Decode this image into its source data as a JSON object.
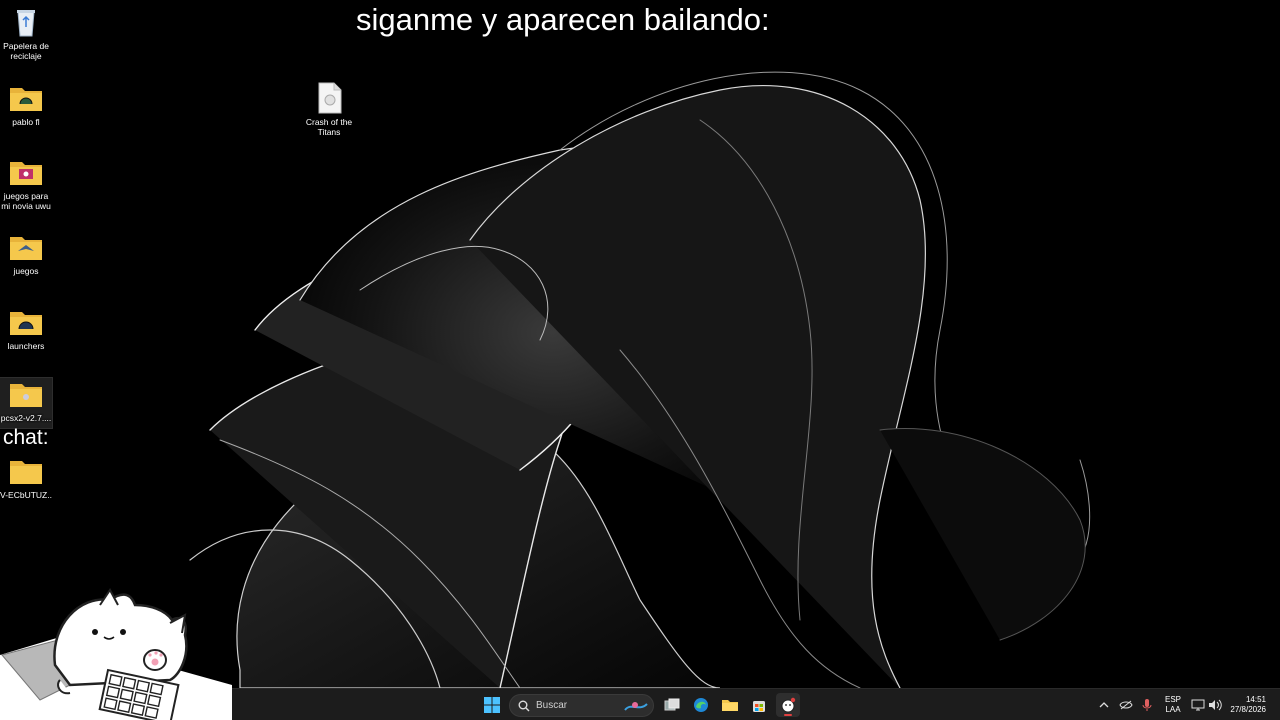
{
  "overlay": {
    "title": "siganme y aparecen bailando:",
    "chat_label": "chat:"
  },
  "desktop_icons": [
    {
      "label": "Papelera de reciclaje",
      "icon": "recycle-bin-icon"
    },
    {
      "label": "pablo fl",
      "icon": "folder-icon"
    },
    {
      "label": "juegos para mi novia uwu",
      "icon": "folder-icon"
    },
    {
      "label": "juegos",
      "icon": "folder-icon"
    },
    {
      "label": "launchers",
      "icon": "folder-icon"
    },
    {
      "label": "pcsx2-v2.7....",
      "icon": "folder-icon"
    },
    {
      "label": "V-ECbUTUZ...",
      "icon": "folder-icon"
    },
    {
      "label": "Crash of the Titans",
      "icon": "file-icon"
    }
  ],
  "taskbar": {
    "search_placeholder": "Buscar",
    "pinned": [
      "start-icon",
      "search-icon",
      "task-view-icon",
      "edge-icon",
      "file-explorer-icon",
      "store-icon",
      "bongo-app-icon"
    ],
    "tray": {
      "language_top": "ESP",
      "language_bottom": "LAA",
      "time": "14:51",
      "date": "27/8/2026"
    }
  },
  "colors": {
    "taskbar_bg": "#1c1c1c",
    "folder_yellow": "#f5c84c",
    "accent_red": "#e04040"
  }
}
